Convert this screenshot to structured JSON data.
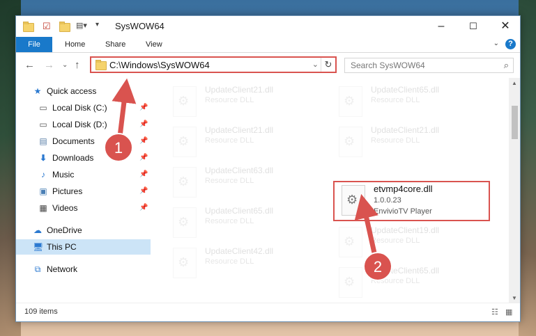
{
  "window": {
    "title": "SysWOW64",
    "controls": [
      "minimize",
      "maximize",
      "close"
    ]
  },
  "quick_access_toolbar": [
    "folder-icon",
    "properties-icon",
    "new-folder-icon",
    "customize-icon"
  ],
  "ribbon": {
    "tabs": [
      {
        "label": "File",
        "active": true
      },
      {
        "label": "Home"
      },
      {
        "label": "Share"
      },
      {
        "label": "View"
      }
    ]
  },
  "address_bar": {
    "path": "C:\\Windows\\SysWOW64"
  },
  "search": {
    "placeholder": "Search SysWOW64"
  },
  "nav_pane": {
    "items": [
      {
        "label": "Quick access",
        "icon": "star-icon",
        "pinned": false,
        "level": 0
      },
      {
        "label": "Local Disk (C:)",
        "icon": "drive-icon",
        "pinned": true,
        "level": 1
      },
      {
        "label": "Local Disk (D:)",
        "icon": "drive-icon",
        "pinned": true,
        "level": 1
      },
      {
        "label": "Documents",
        "icon": "documents-icon",
        "pinned": true,
        "level": 1
      },
      {
        "label": "Downloads",
        "icon": "download-icon",
        "pinned": true,
        "level": 1
      },
      {
        "label": "Music",
        "icon": "music-icon",
        "pinned": true,
        "level": 1
      },
      {
        "label": "Pictures",
        "icon": "pictures-icon",
        "pinned": true,
        "level": 1
      },
      {
        "label": "Videos",
        "icon": "videos-icon",
        "pinned": true,
        "level": 1
      },
      {
        "label": "OneDrive",
        "icon": "cloud-icon",
        "pinned": false,
        "level": 0
      },
      {
        "label": "This PC",
        "icon": "computer-icon",
        "pinned": false,
        "level": 0,
        "selected": true
      },
      {
        "label": "Network",
        "icon": "network-icon",
        "pinned": false,
        "level": 0
      }
    ]
  },
  "files": [
    {
      "name": "UpdateClient21.dll",
      "type": "Resource DLL",
      "faded": true
    },
    {
      "name": "UpdateClient65.dll",
      "type": "Resource DLL",
      "faded": true
    },
    {
      "name": "UpdateClient21.dll",
      "type": "Resource DLL",
      "faded": true
    },
    {
      "name": "UpdateClient21.dll",
      "type": "Resource DLL",
      "faded": true
    },
    {
      "name": "UpdateClient63.dll",
      "type": "Resource DLL",
      "faded": true
    },
    {
      "name": "etvmp4core.dll",
      "version": "1.0.0.23",
      "type": "EnvivioTV Player",
      "faded": false,
      "highlighted": true
    },
    {
      "name": "UpdateClient65.dll",
      "type": "Resource DLL",
      "faded": true
    },
    {
      "name": "UpdateClient19.dll",
      "type": "Resource DLL",
      "faded": true
    },
    {
      "name": "UpdateClient42.dll",
      "type": "Resource DLL",
      "faded": true
    },
    {
      "name": "UpdateClient65.dll",
      "type": "Resource DLL",
      "faded": true
    }
  ],
  "status": {
    "item_count": "109 items"
  },
  "annotations": {
    "step1_label": "1",
    "step2_label": "2",
    "color": "#d9534f"
  }
}
